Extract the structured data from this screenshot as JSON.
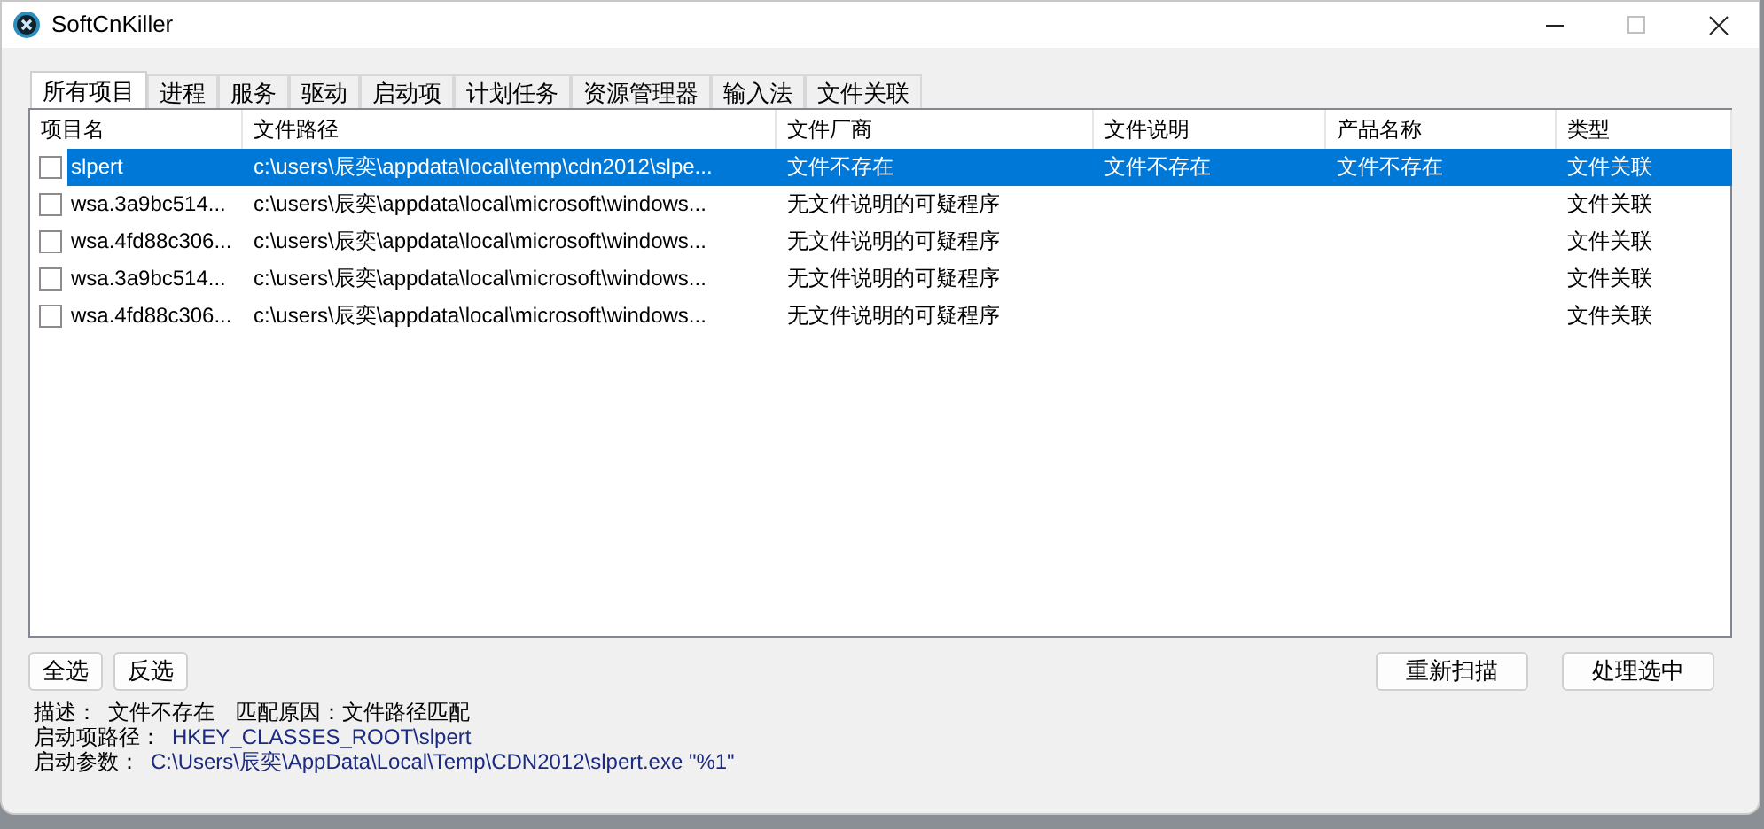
{
  "window": {
    "title": "SoftCnKiller"
  },
  "tabs": [
    {
      "label": "所有项目",
      "selected": true
    },
    {
      "label": "进程",
      "selected": false
    },
    {
      "label": "服务",
      "selected": false
    },
    {
      "label": "驱动",
      "selected": false
    },
    {
      "label": "启动项",
      "selected": false
    },
    {
      "label": "计划任务",
      "selected": false
    },
    {
      "label": "资源管理器",
      "selected": false
    },
    {
      "label": "输入法",
      "selected": false
    },
    {
      "label": "文件关联",
      "selected": false
    }
  ],
  "table": {
    "columns": [
      "项目名",
      "文件路径",
      "文件厂商",
      "文件说明",
      "产品名称",
      "类型"
    ],
    "rows": [
      {
        "selected": true,
        "checked": false,
        "cells": [
          "slpert",
          "c:\\users\\辰奕\\appdata\\local\\temp\\cdn2012\\slpe...",
          "文件不存在",
          "文件不存在",
          "文件不存在",
          "文件关联"
        ]
      },
      {
        "selected": false,
        "checked": false,
        "cells": [
          "wsa.3a9bc514...",
          "c:\\users\\辰奕\\appdata\\local\\microsoft\\windows...",
          "无文件说明的可疑程序",
          "",
          "",
          "文件关联"
        ]
      },
      {
        "selected": false,
        "checked": false,
        "cells": [
          "wsa.4fd88c306...",
          "c:\\users\\辰奕\\appdata\\local\\microsoft\\windows...",
          "无文件说明的可疑程序",
          "",
          "",
          "文件关联"
        ]
      },
      {
        "selected": false,
        "checked": false,
        "cells": [
          "wsa.3a9bc514...",
          "c:\\users\\辰奕\\appdata\\local\\microsoft\\windows...",
          "无文件说明的可疑程序",
          "",
          "",
          "文件关联"
        ]
      },
      {
        "selected": false,
        "checked": false,
        "cells": [
          "wsa.4fd88c306...",
          "c:\\users\\辰奕\\appdata\\local\\microsoft\\windows...",
          "无文件说明的可疑程序",
          "",
          "",
          "文件关联"
        ]
      }
    ]
  },
  "left_buttons": [
    "全选",
    "反选"
  ],
  "right_buttons": [
    "重新扫描",
    "处理选中"
  ],
  "details": [
    {
      "label": "描述：",
      "value": "文件不存在　匹配原因：文件路径匹配"
    },
    {
      "label": "启动项路径：",
      "value": "HKEY_CLASSES_ROOT\\slpert"
    },
    {
      "label": "启动参数：",
      "value": "C:\\Users\\辰奕\\AppData\\Local\\Temp\\CDN2012\\slpert.exe \"%1\""
    }
  ]
}
